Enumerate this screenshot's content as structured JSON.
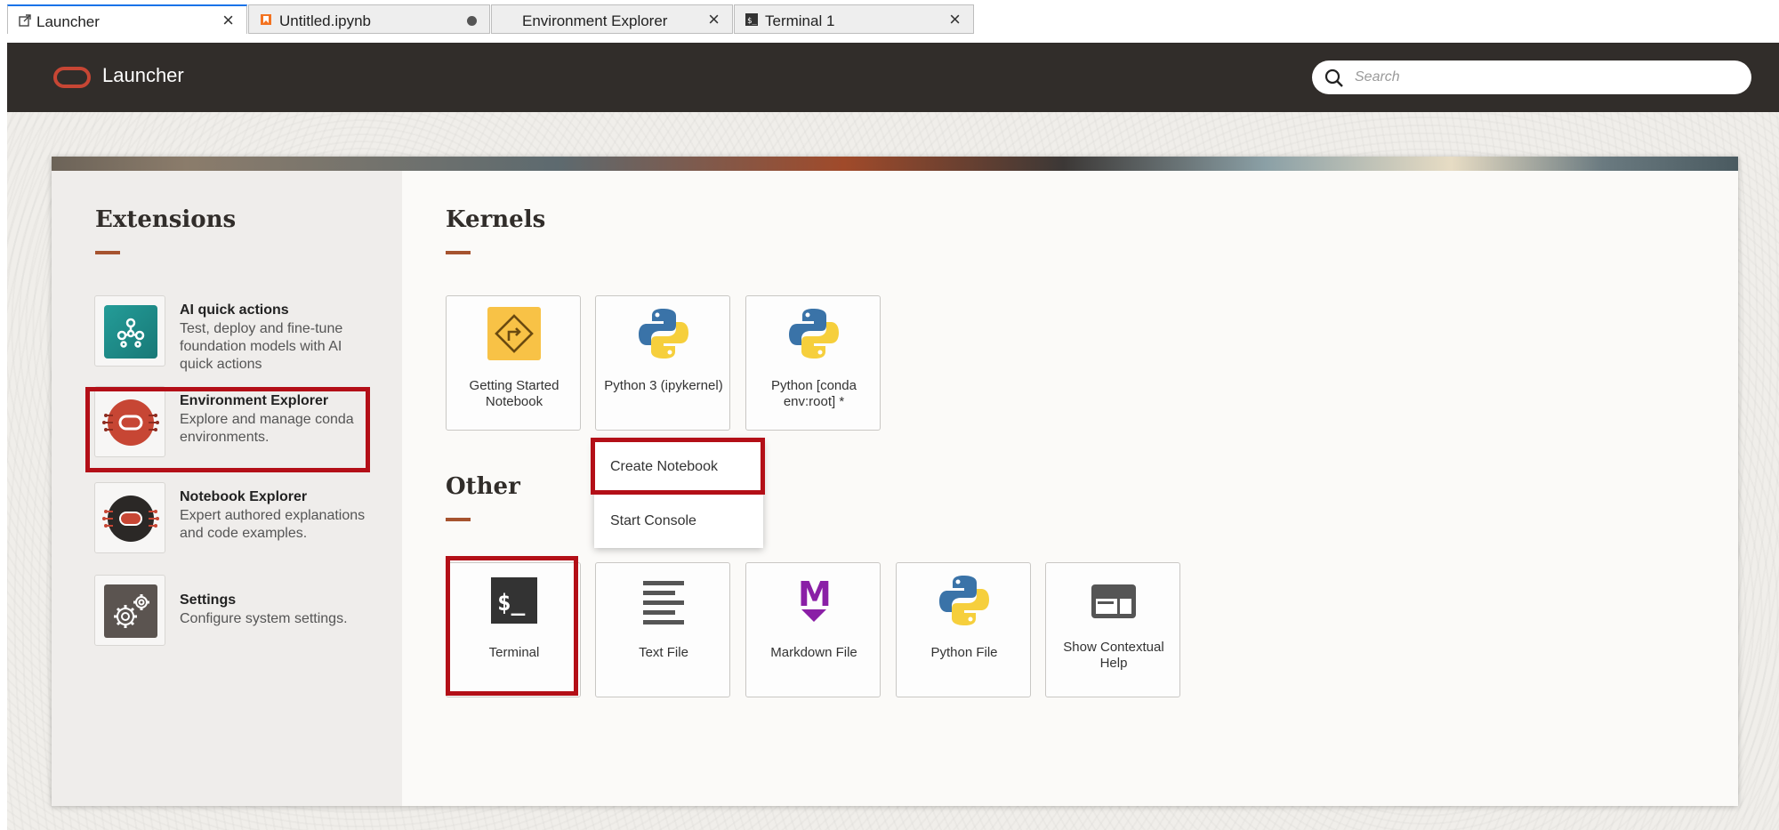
{
  "tabs": [
    {
      "label": "Launcher",
      "icon": "launcher-icon",
      "active": true,
      "trailing": "close"
    },
    {
      "label": "Untitled.ipynb",
      "icon": "notebook-icon",
      "active": false,
      "trailing": "unsaved-dot"
    },
    {
      "label": "Environment Explorer",
      "icon": "",
      "active": false,
      "trailing": "close"
    },
    {
      "label": "Terminal 1",
      "icon": "terminal-icon",
      "active": false,
      "trailing": "close"
    }
  ],
  "header": {
    "title": "Launcher",
    "search_placeholder": "Search"
  },
  "extensions": {
    "title": "Extensions",
    "items": [
      {
        "name": "AI quick actions",
        "description": "Test, deploy and fine-tune foundation models with AI quick actions",
        "icon": "ai-quick-actions-icon"
      },
      {
        "name": "Environment Explorer",
        "description": "Explore and manage conda environments.",
        "icon": "environment-explorer-icon"
      },
      {
        "name": "Notebook Explorer",
        "description": "Expert authored explanations and code examples.",
        "icon": "notebook-explorer-icon"
      },
      {
        "name": "Settings",
        "description": "Configure system settings.",
        "icon": "settings-gear-icon"
      }
    ]
  },
  "kernels": {
    "title": "Kernels",
    "items": [
      {
        "label": "Getting Started Notebook",
        "icon": "getting-started-icon"
      },
      {
        "label": "Python 3 (ipykernel)",
        "icon": "python-icon"
      },
      {
        "label": "Python [conda env:root] *",
        "icon": "python-icon"
      }
    ]
  },
  "context_menu": {
    "items": [
      "Create Notebook",
      "Start Console"
    ]
  },
  "other": {
    "title": "Other",
    "items": [
      {
        "label": "Terminal",
        "icon": "terminal-icon"
      },
      {
        "label": "Text File",
        "icon": "text-file-icon"
      },
      {
        "label": "Markdown File",
        "icon": "markdown-icon"
      },
      {
        "label": "Python File",
        "icon": "python-icon"
      },
      {
        "label": "Show Contextual Help",
        "icon": "contextual-help-icon"
      }
    ]
  },
  "colors": {
    "header_bg": "#312d2a",
    "accent": "#c74634",
    "underline": "#a6532f",
    "highlight": "#b30f17",
    "python_blue": "#3a73a8",
    "python_yellow": "#f6cf3c",
    "markdown_purple": "#8a1fa6"
  }
}
